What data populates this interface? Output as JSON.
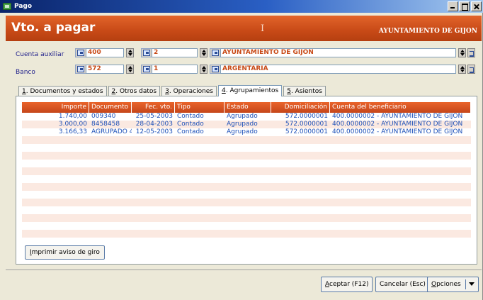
{
  "window": {
    "title": "Pago"
  },
  "header": {
    "title": "Vto. a pagar",
    "cursor": "I",
    "entity": "AYUNTAMIENTO DE GIJON"
  },
  "form": {
    "cuenta": {
      "label": "Cuenta auxiliar",
      "code": "400",
      "sub": "2",
      "name": "AYUNTAMIENTO DE GIJON"
    },
    "banco": {
      "label": "Banco",
      "code": "572",
      "sub": "1",
      "name": "ARGENTARIA"
    }
  },
  "tabs": [
    {
      "num": "1",
      "label": ". Documentos y estados"
    },
    {
      "num": "2",
      "label": ". Otros datos"
    },
    {
      "num": "3",
      "label": ". Operaciones"
    },
    {
      "num": "4",
      "label": ". Agrupamientos"
    },
    {
      "num": "5",
      "label": ". Asientos"
    }
  ],
  "grid": {
    "columns": [
      "Importe",
      "Documento",
      "Fec. vto.",
      "Tipo",
      "Estado",
      "Domiciliación",
      "Cuenta del beneficiario"
    ],
    "rows": [
      [
        "1.740,00",
        "009340",
        "25-05-2003",
        "Contado",
        "Agrupado",
        "572.0000001",
        "400.0000002 - AYUNTAMIENTO DE GIJON"
      ],
      [
        "3.000,00",
        "8458458",
        "28-04-2003",
        "Contado",
        "Agrupado",
        "572.0000001",
        "400.0000002 - AYUNTAMIENTO DE GIJON"
      ],
      [
        "3.166,33",
        "AGRUPADO 4 F",
        "12-05-2003",
        "Contado",
        "Agrupado",
        "572.0000001",
        "400.0000002 - AYUNTAMIENTO DE GIJON"
      ]
    ]
  },
  "buttons": {
    "print": {
      "u": "I",
      "rest": "mprimir aviso de giro"
    },
    "accept": {
      "u": "A",
      "rest": "ceptar (F12)"
    },
    "cancel": "Cancelar (Esc)",
    "options": {
      "u": "O",
      "rest": "pciones"
    }
  }
}
